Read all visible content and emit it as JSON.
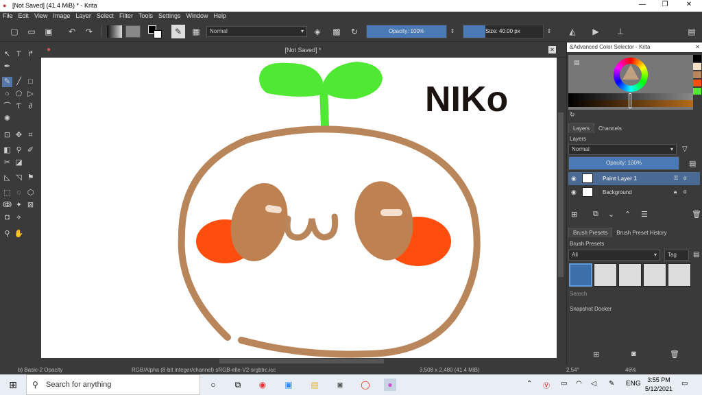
{
  "window": {
    "title": "[Not Saved]  (41.4 MiB)  * - Krita",
    "min_icon": "—",
    "max_icon": "❐",
    "close_icon": "✕"
  },
  "menu": [
    "File",
    "Edit",
    "View",
    "Image",
    "Layer",
    "Select",
    "Filter",
    "Tools",
    "Settings",
    "Window",
    "Help"
  ],
  "toolbar": {
    "blend_mode": "Normal",
    "opacity_label": "Opacity: 100%",
    "opacity_value": 1.0,
    "size_label": "Size: 40.00 px"
  },
  "document": {
    "tab_title": "[Not Saved]  *",
    "drawing_text": "NIKo"
  },
  "dock": {
    "color_selector_title": "&Advanced Color Selector - Krita",
    "tabs": [
      "Layers",
      "Channels"
    ],
    "layers_label": "Layers",
    "layer_blend": "Normal",
    "layer_opacity": "Opacity:  100%",
    "layers": [
      {
        "name": "Paint Layer 1",
        "selected": true
      },
      {
        "name": "Background",
        "selected": false
      }
    ],
    "preset_tabs": [
      "Brush Presets",
      "Brush Preset History"
    ],
    "presets_label": "Brush Presets",
    "preset_filter": "All",
    "tag_label": "Tag",
    "search_placeholder": "Search",
    "snapshot_label": "Snapshot Docker"
  },
  "statusbar": {
    "brush": "b) Basic-2 Opacity",
    "color_model": "RGB/Alpha (8-bit integer/channel)  sRGB-elle-V2-srgbtrc.icc",
    "dimensions": "3,508 x 2,480 (41.4 MiB)",
    "rotation": "2.54°",
    "zoom": "46%"
  },
  "taskbar": {
    "search_text": "Search for anything",
    "time": "3:55 PM",
    "date": "5/12/2021",
    "language": "ENG"
  }
}
